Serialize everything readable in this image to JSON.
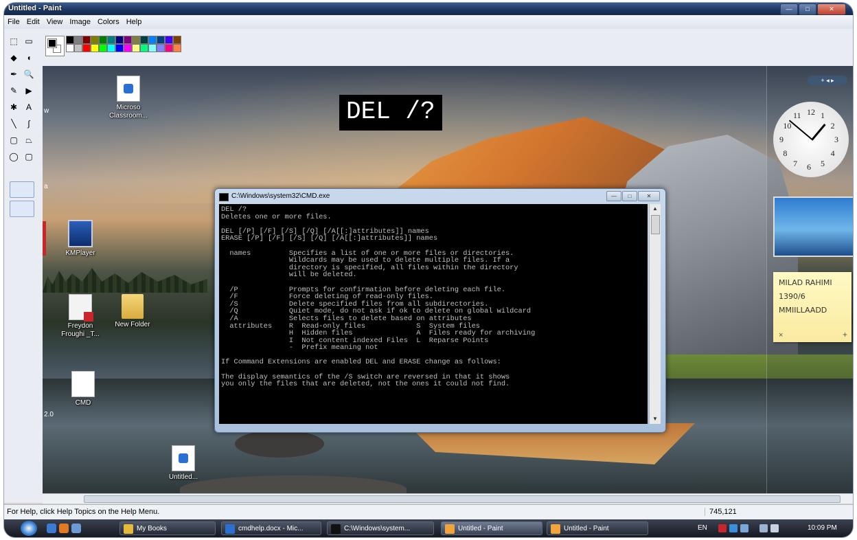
{
  "window": {
    "title": "Untitled - Paint",
    "min_glyph": "—",
    "max_glyph": "□",
    "close_glyph": "✕"
  },
  "menu": [
    "File",
    "Edit",
    "View",
    "Image",
    "Colors",
    "Help"
  ],
  "palette": {
    "colors": [
      "#000000",
      "#808080",
      "#800000",
      "#808000",
      "#008000",
      "#008080",
      "#000080",
      "#800080",
      "#808040",
      "#004040",
      "#0080ff",
      "#004080",
      "#4000ff",
      "#804000",
      "#ffffff",
      "#c0c0c0",
      "#ff0000",
      "#ffff00",
      "#00ff00",
      "#00ffff",
      "#0000ff",
      "#ff00ff",
      "#ffff80",
      "#00ff80",
      "#80ffff",
      "#8080ff",
      "#ff0080",
      "#ff8040"
    ]
  },
  "tools": [
    {
      "name": "free-select-icon",
      "glyph": "⬚"
    },
    {
      "name": "rect-select-icon",
      "glyph": "▭"
    },
    {
      "name": "eraser-icon",
      "glyph": "◆"
    },
    {
      "name": "fill-icon",
      "glyph": "◖"
    },
    {
      "name": "color-picker-icon",
      "glyph": "✒"
    },
    {
      "name": "magnifier-icon",
      "glyph": "🔍"
    },
    {
      "name": "pencil-icon",
      "glyph": "✎"
    },
    {
      "name": "brush-icon",
      "glyph": "▶"
    },
    {
      "name": "airbrush-icon",
      "glyph": "✱"
    },
    {
      "name": "text-icon",
      "glyph": "A"
    },
    {
      "name": "line-icon",
      "glyph": "╲"
    },
    {
      "name": "curve-icon",
      "glyph": "∫"
    },
    {
      "name": "rectangle-icon",
      "glyph": "▢"
    },
    {
      "name": "polygon-icon",
      "glyph": "⏢"
    },
    {
      "name": "ellipse-icon",
      "glyph": "◯"
    },
    {
      "name": "rounded-rect-icon",
      "glyph": "▢"
    }
  ],
  "canvas": {
    "del_label": "DEL /?",
    "desktop_icons": [
      {
        "label": "Microso\nClassroom..."
      },
      {
        "label": "KMPlayer"
      },
      {
        "label": "Freydon\nFroughi _T..."
      },
      {
        "label": "New Folder"
      },
      {
        "label": "CMD"
      },
      {
        "label": "Untitled..."
      }
    ],
    "left_fragments": [
      "w",
      "a",
      "2.0"
    ],
    "cmd": {
      "title": "C:\\Windows\\system32\\CMD.exe",
      "lines": [
        "DEL /?",
        "Deletes one or more files.",
        "",
        "DEL [/P] [/F] [/S] [/Q] [/A[[:]attributes]] names",
        "ERASE [/P] [/F] [/S] [/Q] [/A[[:]attributes]] names",
        "",
        "  names         Specifies a list of one or more files or directories.",
        "                Wildcards may be used to delete multiple files. If a",
        "                directory is specified, all files within the directory",
        "                will be deleted.",
        "",
        "  /P            Prompts for confirmation before deleting each file.",
        "  /F            Force deleting of read-only files.",
        "  /S            Delete specified files from all subdirectories.",
        "  /Q            Quiet mode, do not ask if ok to delete on global wildcard",
        "  /A            Selects files to delete based on attributes",
        "  attributes    R  Read-only files            S  System files",
        "                H  Hidden files               A  Files ready for archiving",
        "                I  Not content indexed Files  L  Reparse Points",
        "                -  Prefix meaning not",
        "",
        "If Command Extensions are enabled DEL and ERASE change as follows:",
        "",
        "The display semantics of the /S switch are reversed in that it shows",
        "you only the files that are deleted, not the ones it could not find."
      ]
    },
    "sidebar": {
      "clock_numbers": [
        "12",
        "1",
        "2",
        "3",
        "4",
        "5",
        "6",
        "7",
        "8",
        "9",
        "10",
        "11"
      ],
      "note_lines": [
        "MILAD RAHIMI",
        "1390/6",
        "MMIILLAADD"
      ],
      "note_add": "+",
      "note_close": "×"
    }
  },
  "status": {
    "help_text": "For Help, click Help Topics on the Help Menu.",
    "coords": "745,121"
  },
  "taskbar": {
    "items": [
      {
        "label": "My Books",
        "color": "#e6b93a"
      },
      {
        "label": "cmdhelp.docx - Mic...",
        "color": "#2a6fd1"
      },
      {
        "label": "C:\\Windows\\system...",
        "color": "#111111"
      },
      {
        "label": "Untitled - Paint",
        "color": "#f2a33c"
      },
      {
        "label": "Untitled - Paint",
        "color": "#f2a33c"
      }
    ],
    "lang": "EN",
    "time": "10:09 PM"
  }
}
